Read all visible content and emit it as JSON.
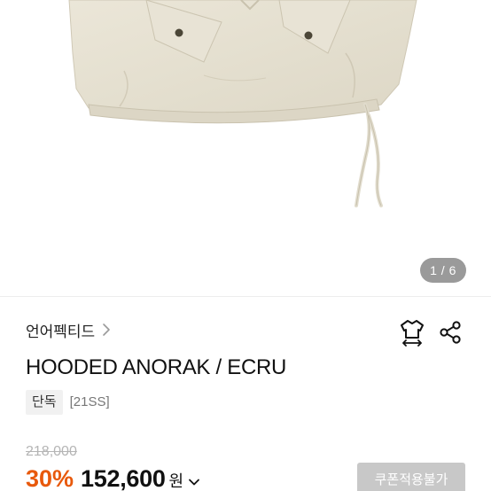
{
  "product_image": {
    "alt": "HOODED ANORAK / ECRU",
    "pager": {
      "current": 1,
      "total": 6,
      "label": "1 / 6"
    }
  },
  "brand": {
    "name": "언어펙티드",
    "chevron_icon": "chevron-right-icon"
  },
  "actions": {
    "fit_icon": "jacket-size-icon",
    "share_icon": "share-icon"
  },
  "title": "HOODED ANORAK / ECRU",
  "tags": {
    "exclusive": "단독",
    "season": "[21SS]"
  },
  "pricing": {
    "original": "218,000",
    "discount": "30%",
    "sale": "152,600",
    "currency": "원",
    "toggle_icon": "chevron-down-icon",
    "coupon_button": "쿠폰적용불가"
  },
  "colors": {
    "discount": "#e8590c",
    "garment": "#e6e1d3",
    "coupon_disabled": "#c8c8c8",
    "pager_bg": "#9a9a9a"
  }
}
